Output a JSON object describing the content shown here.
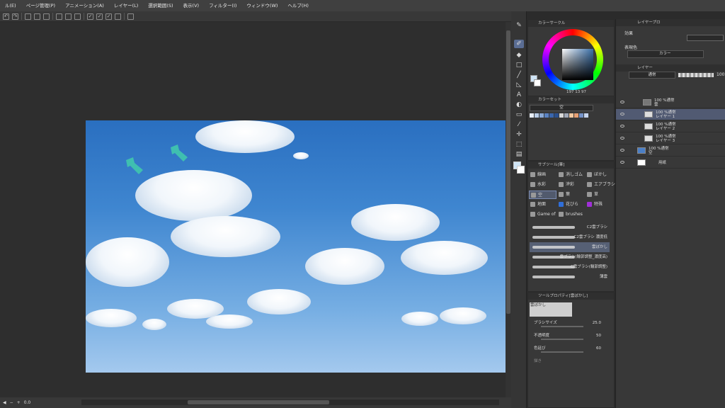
{
  "menubar": {
    "items": [
      "ル(E)",
      "ページ管理(P)",
      "アニメーション(A)",
      "レイヤー(L)",
      "選択範囲(S)",
      "表示(V)",
      "フィルター(I)",
      "ウィンドウ(W)",
      "ヘルプ(H)"
    ]
  },
  "status": {
    "zoom": "0.0"
  },
  "color_panel": {
    "title": "カラーサークル",
    "values": "197  13  97"
  },
  "colorset_panel": {
    "title": "カラーセット",
    "set_name": "空"
  },
  "subtool_panel": {
    "title": "サブツール[筆]",
    "groups": [
      "線画",
      "消しゴム",
      "ぼかし",
      "水彩",
      "滲彩",
      "エアブラシ",
      "空",
      "葉",
      "草",
      "地面",
      "花びら",
      "特殊",
      "Game of",
      "brushes"
    ],
    "brushes": [
      "C2雲ブラシ",
      "C2雲ブラシ 濃度低",
      "雲ぼかし",
      "雲ブラシ(輪郭調整_濃度高)",
      "C雲ブラシ(輪郭調整)",
      "薄雲"
    ]
  },
  "toolprop_panel": {
    "title": "ツールプロパティ[雲ぼかし]",
    "tool_name": "雲ぼかし",
    "props": [
      {
        "label": "ブラシサイズ",
        "value": "25.0"
      },
      {
        "label": "不透明度",
        "value": "50"
      },
      {
        "label": "色延び",
        "value": "60"
      },
      {
        "label": "描き",
        "value": ""
      }
    ]
  },
  "layer_property": {
    "title": "レイヤープロ",
    "effect_label": "効果",
    "expr_label": "表現色",
    "expr_value": "カラー"
  },
  "layer_panel": {
    "title": "レイヤー",
    "blend_mode": "通常",
    "opacity": "100",
    "layers": [
      {
        "line1": "100 %通常",
        "line2": "雲"
      },
      {
        "line1": "100 %通常",
        "line2": "レイヤー 1"
      },
      {
        "line1": "100 %通常",
        "line2": "レイヤー 2"
      },
      {
        "line1": "100 %通常",
        "line2": "レイヤー 3"
      },
      {
        "line1": "100 %通常",
        "line2": "空"
      },
      {
        "line1": "",
        "line2": "用紙"
      }
    ]
  },
  "colors": {
    "accent": "#5a6d94",
    "sky_top": "#2a6fc0",
    "sky_bottom": "#a4c9ee",
    "arrow": "#3fbfb0"
  }
}
